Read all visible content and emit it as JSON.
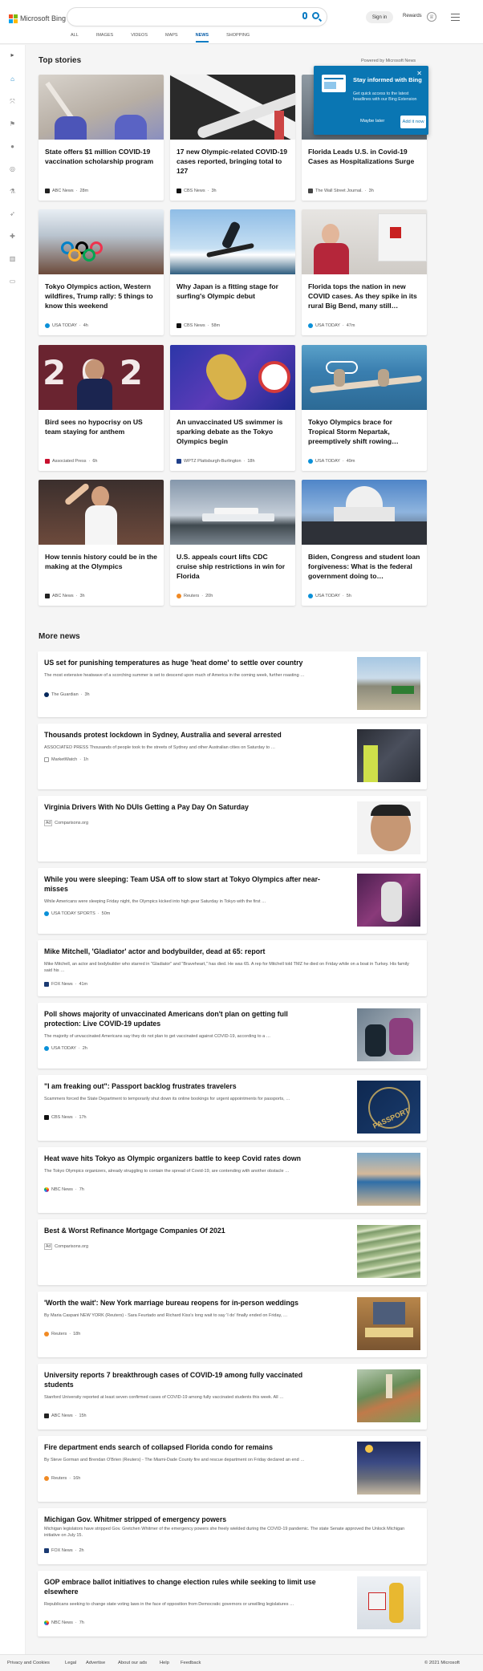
{
  "header": {
    "brand": "Microsoft Bing",
    "sign_in": "Sign in",
    "rewards": "Rewards",
    "tabs": [
      "ALL",
      "IMAGES",
      "VIDEOS",
      "MAPS",
      "NEWS",
      "SHOPPING"
    ],
    "active_tab": "NEWS"
  },
  "sidebar": {
    "icons": [
      "expand-icon",
      "home-icon",
      "shuffle-icon",
      "flag-icon",
      "location-icon",
      "globe-icon",
      "science-icon",
      "rocket-icon",
      "health-icon",
      "building-icon",
      "money-icon"
    ]
  },
  "top_stories": {
    "title": "Top stories",
    "powered_by": "Powered by Microsoft News",
    "cards": [
      {
        "title": "State offers $1 million COVID-19 vaccination scholarship program",
        "source": "ABC News",
        "time": "28m"
      },
      {
        "title": "17 new Olympic-related COVID-19 cases reported, bringing total to 127",
        "source": "CBS News",
        "time": "3h"
      },
      {
        "title": "Florida Leads U.S. in Covid-19 Cases as Hospitalizations Surge",
        "source": "The Wall Street Journal.",
        "time": "3h"
      },
      {
        "title": "Tokyo Olympics action, Western wildfires, Trump rally: 5 things to know this weekend",
        "source": "USA TODAY",
        "time": "4h"
      },
      {
        "title": "Why Japan is a fitting stage for surfing's Olympic debut",
        "source": "CBS News",
        "time": "58m"
      },
      {
        "title": "Florida tops the nation in new COVID cases. As they spike in its rural Big Bend, many still…",
        "source": "USA TODAY",
        "time": "47m"
      },
      {
        "title": "Bird sees no hypocrisy on US team staying for anthem",
        "source": "Associated Press",
        "time": "6h"
      },
      {
        "title": "An unvaccinated US swimmer is sparking debate as the Tokyo Olympics begin",
        "source": "WPTZ Plattsburgh-Burlington",
        "time": "18h"
      },
      {
        "title": "Tokyo Olympics brace for Tropical Storm Nepartak, preemptively shift rowing…",
        "source": "USA TODAY",
        "time": "49m"
      },
      {
        "title": "How tennis history could be in the making at the Olympics",
        "source": "ABC News",
        "time": "3h"
      },
      {
        "title": "U.S. appeals court lifts CDC cruise ship restrictions in win for Florida",
        "source": "Reuters",
        "time": "20h"
      },
      {
        "title": "Biden, Congress and student loan forgiveness: What is the federal government doing to…",
        "source": "USA TODAY",
        "time": "5h"
      }
    ]
  },
  "popup": {
    "title": "Stay informed with Bing",
    "description": "Get quick access to the latest headlines with our Bing Extension",
    "maybe_later": "Maybe later",
    "add_it_now": "Add it now"
  },
  "more_news": {
    "title": "More news",
    "items": [
      {
        "title": "US set for punishing temperatures as huge 'heat dome' to settle over country",
        "snippet": "The most extensive heatwave of a scorching summer is set to descend upon much of America in the coming week, further roasting …",
        "source": "The Guardian",
        "time": "3h"
      },
      {
        "title": "Thousands protest lockdown in Sydney, Australia and several arrested",
        "snippet": "ASSOCIATED PRESS Thousands of people took to the streets of Sydney and other Australian cities on Saturday to …",
        "source": "MarketWatch",
        "time": "1h"
      },
      {
        "title": "Virginia Drivers With No DUIs Getting a Pay Day On Saturday",
        "snippet": "",
        "source": "Comparisons.org",
        "time": "",
        "ad": "Ad"
      },
      {
        "title": "While you were sleeping: Team USA off to slow start at Tokyo Olympics after near-misses",
        "snippet": "While Americans were sleeping Friday night, the Olympics kicked into high gear Saturday in Tokyo with the first …",
        "source": "USA TODAY SPORTS",
        "time": "50m"
      },
      {
        "title": "Mike Mitchell, 'Gladiator' actor and bodybuilder, dead at 65: report",
        "snippet": "Mike Mitchell, an actor and bodybuilder who starred in \"Gladiator\" and \"Braveheart,\" has died. He was 65. A rep for Mitchell told TMZ he died on Friday while on a boat in Turkey. His family said his …",
        "source": "FOX News",
        "time": "41m"
      },
      {
        "title": "Poll shows majority of unvaccinated Americans don't plan on getting full protection: Live COVID-19 updates",
        "snippet": "The majority of unvaccinated Americans say they do not plan to get vaccinated against COVID-19, according to a …",
        "source": "USA TODAY",
        "time": "2h"
      },
      {
        "title": "\"I am freaking out\": Passport backlog frustrates travelers",
        "snippet": "Scammers forced the State Department to temporarily shut down its online bookings for urgent appointments for passports, …",
        "source": "CBS News",
        "time": "17h"
      },
      {
        "title": "Heat wave hits Tokyo as Olympic organizers battle to keep Covid rates down",
        "snippet": "The Tokyo Olympics organizers, already struggling to contain the spread of Covid-19, are contending with another obstacle …",
        "source": "NBC News",
        "time": "7h"
      },
      {
        "title": "Best & Worst Refinance Mortgage Companies Of 2021",
        "snippet": "",
        "source": "Comparisons.org",
        "time": "",
        "ad": "Ad"
      },
      {
        "title": "'Worth the wait': New York marriage bureau reopens for in-person weddings",
        "snippet": "By Maria Caspani NEW YORK (Reuters) - Sara Feurtado and Richard Kiss's long wait to say 'I do' finally ended on Friday, …",
        "source": "Reuters",
        "time": "18h"
      },
      {
        "title": "University reports 7 breakthrough cases of COVID-19 among fully vaccinated students",
        "snippet": "Stanford University reported at least seven confirmed cases of COVID-19 among fully vaccinated students this week. All …",
        "source": "ABC News",
        "time": "15h"
      },
      {
        "title": "Fire department ends search of collapsed Florida condo for remains",
        "snippet": "By Steve Gorman and Brendan O'Brien (Reuters) - The Miami-Dade County fire and rescue department on Friday declared an end …",
        "source": "Reuters",
        "time": "16h"
      },
      {
        "title": "Michigan Gov. Whitmer stripped of emergency powers",
        "snippet": "Michigan legislators have stripped Gov. Gretchen Whitmer of the emergency powers she freely wielded during the COVID-19 pandemic. The state Senate approved the Unlock Michigan initiative on July 15.",
        "source": "FOX News",
        "time": "2h"
      },
      {
        "title": "GOP embrace ballot initiatives to change election rules while seeking to limit use elsewhere",
        "snippet": "Republicans seeking to change state voting laws in the face of opposition from Democratic governors or unwilling legislatures …",
        "source": "NBC News",
        "time": "7h"
      }
    ]
  },
  "footer": {
    "links": [
      "Privacy and Cookies",
      "Legal",
      "Advertise",
      "About our ads",
      "Help",
      "Feedback"
    ],
    "copyright": "© 2021 Microsoft"
  },
  "colors": {
    "accent": "#0a7cc3",
    "popup_bg": "#0a76b3",
    "page_bg": "#f5f5f5"
  }
}
